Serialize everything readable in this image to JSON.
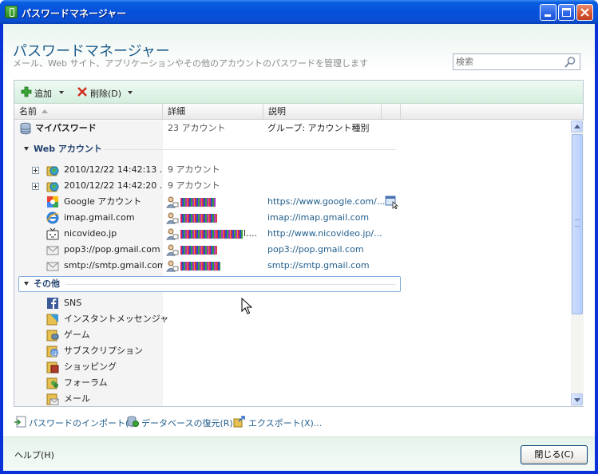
{
  "window": {
    "title": "パスワードマネージャー"
  },
  "header": {
    "title": "パスワードマネージャー",
    "subtitle": "メール、Web サイト、アプリケーションやその他のアカウントのパスワードを管理します",
    "search_placeholder": "検索"
  },
  "toolbar": {
    "add_label": "追加",
    "delete_label": "削除(D)"
  },
  "columns": {
    "name": "名前",
    "detail": "詳細",
    "description": "説明"
  },
  "root": {
    "name": "マイパスワード",
    "detail": "23 アカウント",
    "description": "グループ: アカウント種別"
  },
  "groups": {
    "web": {
      "title": "Web アカウント",
      "folders": [
        {
          "name": "2010/12/22 14:42:13 ...",
          "detail": "9 アカウント"
        },
        {
          "name": "2010/12/22 14:42:20 ...",
          "detail": "9 アカウント"
        }
      ],
      "accounts": [
        {
          "name": "Google アカウント",
          "user_suffix": "",
          "url": "https://www.google.com/...",
          "icon": "google-icon"
        },
        {
          "name": "imap.gmail.com",
          "user_suffix": "",
          "url": "imap://imap.gmail.com",
          "icon": "ie-icon"
        },
        {
          "name": "nicovideo.jp",
          "user_suffix": "l....",
          "url": "http://www.nicovideo.jp/...",
          "icon": "nicovideo-icon"
        },
        {
          "name": "pop3://pop.gmail.com",
          "user_suffix": "",
          "url": "pop3://pop.gmail.com",
          "icon": "mail-icon"
        },
        {
          "name": "smtp://smtp.gmail.com",
          "user_suffix": "",
          "url": "smtp://smtp.gmail.com",
          "icon": "mail-icon"
        }
      ]
    },
    "other": {
      "title": "その他",
      "items": [
        {
          "name": "SNS",
          "icon": "facebook-icon"
        },
        {
          "name": "インスタントメッセンジャー",
          "icon": "messenger-icon"
        },
        {
          "name": "ゲーム",
          "icon": "game-icon"
        },
        {
          "name": "サブスクリプション",
          "icon": "subscription-icon"
        },
        {
          "name": "ショッピング",
          "icon": "shopping-icon"
        },
        {
          "name": "フォーラム",
          "icon": "forum-icon"
        },
        {
          "name": "メール",
          "icon": "mail-folder-icon"
        }
      ]
    }
  },
  "bottom_links": {
    "import": "パスワードのインポート(I)",
    "restore": "データベースの復元(R)",
    "export": "エクスポート(X)..."
  },
  "footer": {
    "help": "ヘルプ(H)",
    "close": "閉じる(C)"
  },
  "colors": {
    "accent": "#1f5d8c",
    "titlebar": "#0550dc",
    "toolbar_bg": "#d4eede"
  }
}
